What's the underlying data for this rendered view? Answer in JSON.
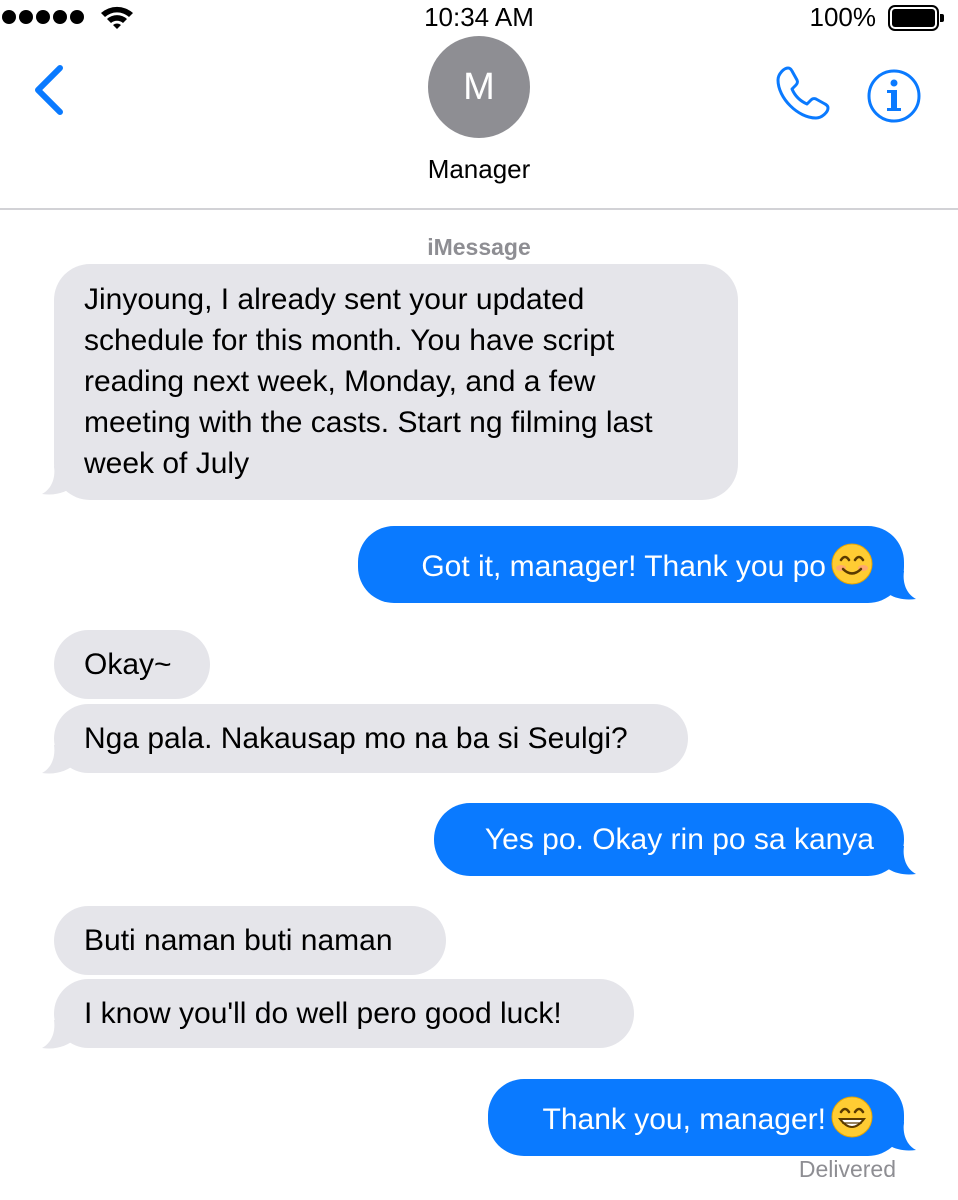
{
  "status_bar": {
    "time": "10:34 AM",
    "battery_percent": "100%",
    "signal_bars": 5,
    "battery_level": 1.0
  },
  "header": {
    "avatar_initial": "M",
    "contact_name": "Manager",
    "icons": [
      "chevron-left-icon",
      "phone-icon",
      "info-icon"
    ]
  },
  "conversation": {
    "service_label": "iMessage",
    "messages": [
      {
        "direction": "incoming",
        "lines": [
          "Jinyoung, I already sent your updated",
          "schedule for this month. You have script",
          "reading next week, Monday, and a few",
          "meeting with the casts. Start ng filming last",
          "week of July"
        ]
      },
      {
        "direction": "outgoing",
        "text": "Got it, manager! Thank you po",
        "emoji": "smiling-face-emoji"
      },
      {
        "direction": "incoming",
        "text": "Okay~"
      },
      {
        "direction": "incoming",
        "text": "Nga pala. Nakausap mo na ba si Seulgi?"
      },
      {
        "direction": "outgoing",
        "text": "Yes po. Okay rin po sa kanya"
      },
      {
        "direction": "incoming",
        "text": "Buti naman buti naman"
      },
      {
        "direction": "incoming",
        "text": "I know you'll do well pero good luck!"
      },
      {
        "direction": "outgoing",
        "text": "Thank you, manager!",
        "emoji": "grinning-face-emoji"
      }
    ],
    "delivery_status": "Delivered"
  },
  "colors": {
    "accent": "#0a7aff",
    "incoming_bubble": "#e5e5ea",
    "outgoing_bubble": "#0a7aff",
    "secondary_text": "#8e8e93",
    "avatar_bg": "#8e8e93"
  }
}
